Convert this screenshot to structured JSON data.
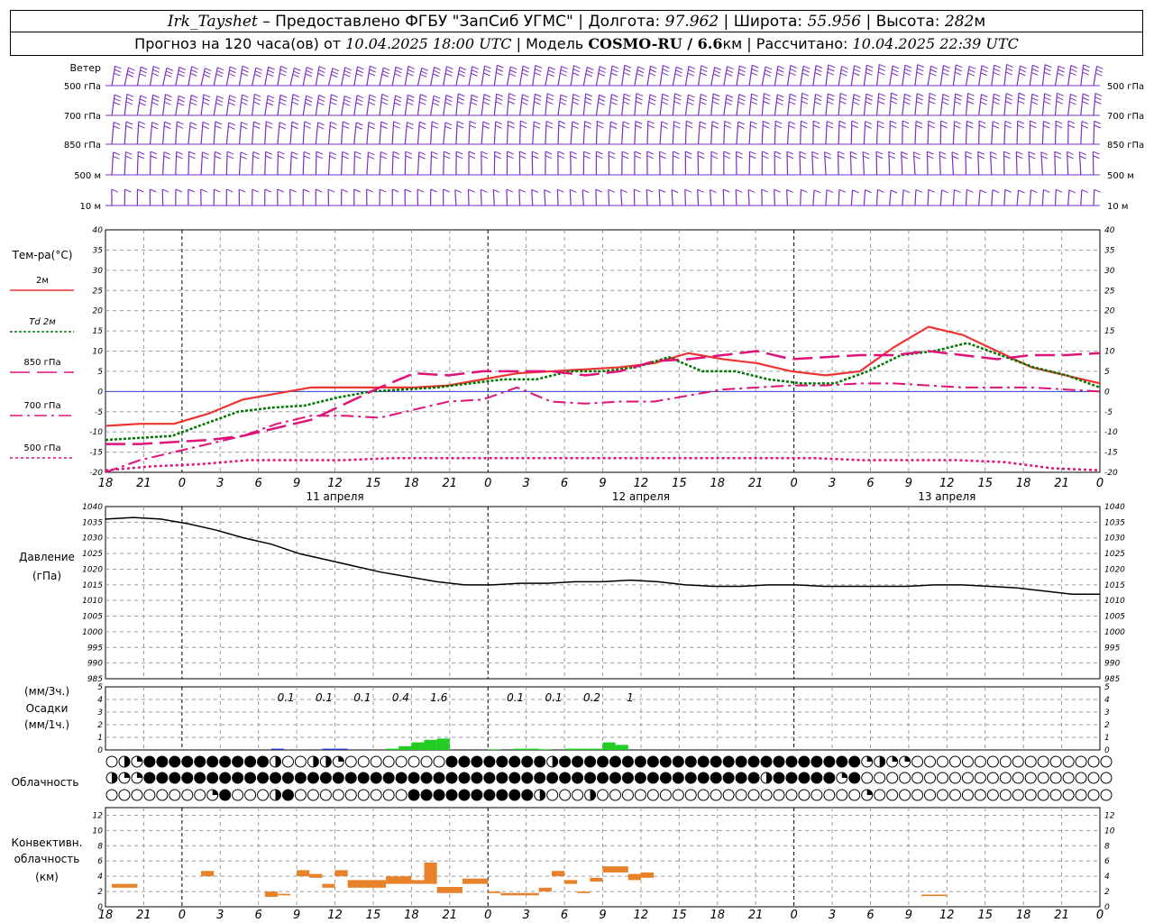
{
  "header": {
    "station": "Irk_Tayshet",
    "provider": " – Предоставлено ФГБУ \"ЗапСиб УГМС\" | Долгота: ",
    "lon": "97.962",
    "lat_label": " | Широта: ",
    "lat": "55.956",
    "alt_label": " | Высота: ",
    "alt": "282",
    "alt_unit": "м",
    "forecast_label": "Прогноз на 120 часа(ов) от ",
    "forecast_start": "10.04.2025 18:00 UTC",
    "model_label": "  | Модель ",
    "model": "COSMO-RU / 6.6",
    "model_unit": "км",
    "calc_label": " | Рассчитано: ",
    "calc_time": "10.04.2025 22:39 UTC"
  },
  "time_axis": {
    "ticks": [
      "18",
      "21",
      "0",
      "3",
      "6",
      "9",
      "12",
      "15",
      "18",
      "21",
      "0",
      "3",
      "6",
      "9",
      "12",
      "15",
      "18",
      "21",
      "0",
      "3",
      "6",
      "9",
      "12",
      "15",
      "18",
      "21",
      "0"
    ],
    "days": [
      "11 апреля",
      "12 апреля",
      "13 апреля"
    ]
  },
  "wind": {
    "title": "Ветер",
    "levels": [
      "500 гПа",
      "700 гПа",
      "850 гПа",
      "500 м",
      "10  м"
    ],
    "color": "#7a2fc4"
  },
  "chart_data": [
    {
      "type": "line",
      "title": "Тем-ра(°C)",
      "ylim": [
        -20,
        40
      ],
      "yticks": [
        40,
        35,
        30,
        25,
        20,
        15,
        10,
        5,
        0,
        -5,
        -10,
        -15,
        -20
      ],
      "grid": true,
      "x_hours": [
        0,
        3,
        6,
        9,
        12,
        15,
        18,
        21,
        24,
        27,
        30,
        33,
        36,
        39,
        42,
        45,
        48,
        51,
        54,
        57,
        60,
        63,
        66,
        69,
        72,
        75,
        78
      ],
      "series": [
        {
          "name": "2м",
          "color": "#ee3333",
          "values": [
            -8.5,
            -8,
            -8,
            -5.5,
            -2,
            -0.5,
            1,
            1,
            1,
            1,
            1.5,
            3,
            4.5,
            5,
            5.5,
            6,
            7,
            9.5,
            8,
            7,
            5,
            4,
            5,
            11,
            16,
            14,
            10,
            6,
            4,
            2
          ]
        },
        {
          "name": "Td  2м",
          "color": "#007700",
          "values": [
            -12,
            -11.5,
            -11,
            -8,
            -5,
            -4,
            -3.5,
            -1.5,
            0,
            0.5,
            1,
            2,
            3,
            3,
            5,
            5,
            6,
            8.5,
            5,
            5,
            3,
            2,
            2,
            5,
            9,
            10,
            12,
            9,
            6,
            4,
            1
          ]
        },
        {
          "name": "850 гПа",
          "color": "#e0127a",
          "values": [
            -13,
            -13,
            -12.5,
            -12,
            -11,
            -9,
            -7,
            -3,
            1,
            4.5,
            4,
            5,
            5,
            5,
            4,
            5,
            7.5,
            8,
            9,
            10,
            8,
            8.5,
            9,
            9,
            10,
            9,
            8,
            9,
            9,
            9.5
          ]
        },
        {
          "name": "700 гПа",
          "color": "#e0127a",
          "values": [
            -20,
            -17,
            -15,
            -13,
            -11,
            -8,
            -6,
            -6,
            -6.5,
            -4.5,
            -2.5,
            -2,
            1,
            -2.5,
            -3,
            -2.5,
            -2.5,
            -1,
            0.5,
            1,
            1.5,
            1.5,
            2,
            2,
            1.5,
            1,
            1,
            1,
            0.5,
            0
          ]
        },
        {
          "name": "500 гПа",
          "color": "#e0127a",
          "values": [
            -19.5,
            -18.5,
            -18,
            -17,
            -17,
            -17,
            -16.5,
            -16.5,
            -16.5,
            -16.5,
            -16.5,
            -16.5,
            -16.5,
            -16.5,
            -16.5,
            -16.5,
            -17,
            -17,
            -17,
            -17.5,
            -19,
            -19.5
          ]
        }
      ]
    },
    {
      "type": "line",
      "title": "Давление",
      "ylabel": "(гПа)",
      "ylim": [
        985,
        1040
      ],
      "yticks": [
        1040,
        1035,
        1030,
        1025,
        1020,
        1015,
        1010,
        1005,
        1000,
        995,
        990,
        985
      ],
      "grid": true,
      "series": [
        {
          "name": "Давление",
          "color": "#000000",
          "values": [
            1036,
            1036.5,
            1036,
            1034.5,
            1032.5,
            1030,
            1028,
            1025,
            1023,
            1021,
            1019,
            1017.5,
            1016,
            1015,
            1015,
            1015.5,
            1015.5,
            1016,
            1016,
            1016.5,
            1016,
            1015,
            1014.5,
            1014.5,
            1015,
            1015,
            1014.5,
            1014.5,
            1014.5,
            1014.5,
            1015,
            1015,
            1014.5,
            1014,
            1013,
            1012,
            1012
          ]
        }
      ]
    },
    {
      "type": "bar",
      "title": "Осадки",
      "ylabel_top": "(мм/3ч.)",
      "ylabel_bottom": "(мм/1ч.)",
      "ylim": [
        0,
        5
      ],
      "yticks": [
        5,
        4,
        3,
        2,
        1,
        0
      ],
      "labels": [
        {
          "hour": 15,
          "text": "0.1"
        },
        {
          "hour": 18,
          "text": "0.1"
        },
        {
          "hour": 21,
          "text": "0.1"
        },
        {
          "hour": 24,
          "text": "0.4"
        },
        {
          "hour": 27,
          "text": "1.6"
        },
        {
          "hour": 33,
          "text": "0.1"
        },
        {
          "hour": 36,
          "text": "0.1"
        },
        {
          "hour": 39,
          "text": "0.2"
        },
        {
          "hour": 42,
          "text": "1"
        }
      ],
      "bars": [
        {
          "hour": 13,
          "value": 0.1,
          "color": "#2233cc"
        },
        {
          "hour": 17,
          "value": 0.1,
          "color": "#2233cc"
        },
        {
          "hour": 18,
          "value": 0.1,
          "color": "#2233cc"
        },
        {
          "hour": 22,
          "value": 0.1,
          "color": "#22cc22"
        },
        {
          "hour": 23,
          "value": 0.3,
          "color": "#22cc22"
        },
        {
          "hour": 24,
          "value": 0.6,
          "color": "#22cc22"
        },
        {
          "hour": 25,
          "value": 0.8,
          "color": "#22cc22"
        },
        {
          "hour": 26,
          "value": 0.9,
          "color": "#22cc22"
        },
        {
          "hour": 30,
          "value": 0.05,
          "color": "#22cc22"
        },
        {
          "hour": 32,
          "value": 0.1,
          "color": "#22cc22"
        },
        {
          "hour": 33,
          "value": 0.1,
          "color": "#22cc22"
        },
        {
          "hour": 34,
          "value": 0.05,
          "color": "#22cc22"
        },
        {
          "hour": 36,
          "value": 0.1,
          "color": "#22cc22"
        },
        {
          "hour": 37,
          "value": 0.1,
          "color": "#22cc22"
        },
        {
          "hour": 38,
          "value": 0.1,
          "color": "#22cc22"
        },
        {
          "hour": 39,
          "value": 0.6,
          "color": "#22cc22"
        },
        {
          "hour": 40,
          "value": 0.4,
          "color": "#22cc22"
        }
      ]
    },
    {
      "type": "table",
      "title": "Облачность",
      "rows": [
        "ohqffffffffffhoohhqooooooooffffffffhffffffffffffffffffffffffqhqqooooooooooooooooooooq",
        "hqqfffffffffffffffffffffffffffffffffffffffffffffffffhfffffqfooooooooooooooooooooooooo",
        "ooooooooqfooohfoooooooooffffffffffhooohoooooooooooooooooooooqooooooooooooooooooooo"
      ]
    },
    {
      "type": "bar",
      "title": "Конвективн. облачность",
      "ylabel": "(км)",
      "ylim": [
        0,
        13
      ],
      "yticks": [
        12,
        10,
        8,
        6,
        4,
        2,
        0
      ],
      "segments": [
        {
          "h0": 0.5,
          "h1": 2.5,
          "base": 2.5,
          "top": 3.0
        },
        {
          "h0": 7.5,
          "h1": 8.5,
          "base": 4.0,
          "top": 4.7
        },
        {
          "h0": 12.5,
          "h1": 13.5,
          "base": 1.3,
          "top": 2.0
        },
        {
          "h0": 13.5,
          "h1": 14.5,
          "base": 1.5,
          "top": 1.7
        },
        {
          "h0": 15.0,
          "h1": 16.0,
          "base": 4.0,
          "top": 4.8
        },
        {
          "h0": 16.0,
          "h1": 17.0,
          "base": 3.8,
          "top": 4.3
        },
        {
          "h0": 17.0,
          "h1": 18.0,
          "base": 2.5,
          "top": 3.0
        },
        {
          "h0": 18.0,
          "h1": 19.0,
          "base": 4.0,
          "top": 4.8
        },
        {
          "h0": 19.0,
          "h1": 22.0,
          "base": 2.5,
          "top": 3.5
        },
        {
          "h0": 22.0,
          "h1": 24.0,
          "base": 3.0,
          "top": 4.0
        },
        {
          "h0": 24.0,
          "h1": 25.0,
          "base": 3.0,
          "top": 3.5
        },
        {
          "h0": 25.0,
          "h1": 26.0,
          "base": 3.0,
          "top": 5.8
        },
        {
          "h0": 26.0,
          "h1": 28.0,
          "base": 1.8,
          "top": 2.6
        },
        {
          "h0": 28.0,
          "h1": 30.0,
          "base": 3.0,
          "top": 3.7
        },
        {
          "h0": 30.0,
          "h1": 31.0,
          "base": 1.8,
          "top": 2.0
        },
        {
          "h0": 31.0,
          "h1": 34.0,
          "base": 1.5,
          "top": 1.8
        },
        {
          "h0": 34.0,
          "h1": 35.0,
          "base": 2.0,
          "top": 2.5
        },
        {
          "h0": 35.0,
          "h1": 36.0,
          "base": 4.0,
          "top": 4.7
        },
        {
          "h0": 36.0,
          "h1": 37.0,
          "base": 3.0,
          "top": 3.5
        },
        {
          "h0": 37.0,
          "h1": 38.0,
          "base": 1.8,
          "top": 2.0
        },
        {
          "h0": 38.0,
          "h1": 39.0,
          "base": 3.3,
          "top": 3.8
        },
        {
          "h0": 39.0,
          "h1": 41.0,
          "base": 4.5,
          "top": 5.3
        },
        {
          "h0": 41.0,
          "h1": 42.0,
          "base": 3.5,
          "top": 4.3
        },
        {
          "h0": 42.0,
          "h1": 43.0,
          "base": 3.8,
          "top": 4.5
        },
        {
          "h0": 64.0,
          "h1": 66.0,
          "base": 1.4,
          "top": 1.6
        }
      ],
      "color": "#e8822a"
    }
  ]
}
